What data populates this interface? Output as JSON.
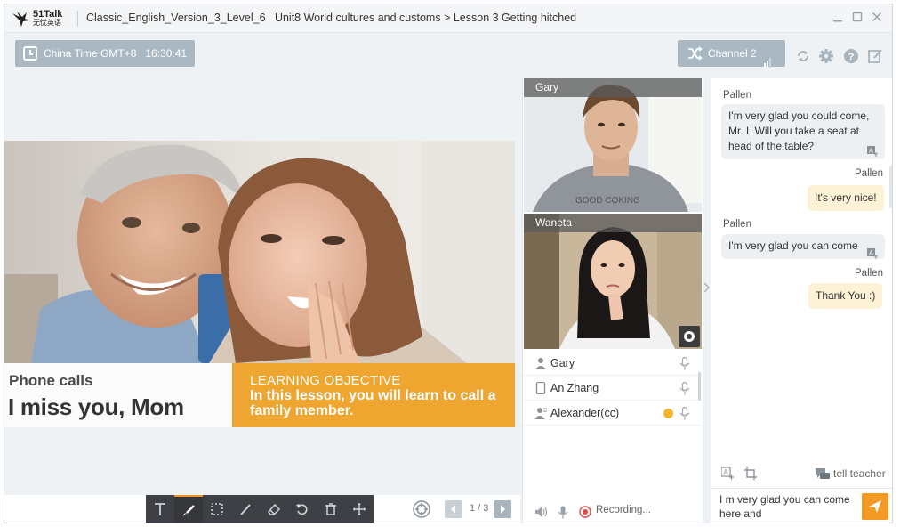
{
  "titlebar": {
    "brand": "51Talk",
    "brand_sub": "无忧英语",
    "title": "Classic_English_Version_3_Level_6   Unit8 World cultures and customs > Lesson 3 Getting hitched",
    "controls": [
      "minimize-icon",
      "maximize-icon",
      "close-icon"
    ]
  },
  "toolbar": {
    "time_label": "China Time GMT+8",
    "time_value": "16:30:41",
    "channel_label": "Channel 2",
    "icons": [
      "refresh-icon",
      "settings-gear-icon",
      "help-icon",
      "feedback-edit-icon"
    ]
  },
  "slide": {
    "title_small": "Phone calls",
    "title_big": "I miss you, Mom",
    "objective_heading": "LEARNING OBJECTIVE",
    "objective_text": "In this lesson, you will learn to call a family member.",
    "objective_color": "#eea631"
  },
  "slide_tools": {
    "tools": [
      "text-tool-icon",
      "brush-tool-icon",
      "select-tool-icon",
      "pen-tool-icon",
      "eraser-tool-icon",
      "undo-icon",
      "delete-icon",
      "move-icon"
    ],
    "active_tool": "brush-tool-icon",
    "page_current": "1",
    "page_total": "3",
    "page_text": "1 / 3"
  },
  "videos": [
    {
      "name": "Gary"
    },
    {
      "name": "Waneta"
    }
  ],
  "members": [
    {
      "name": "Gary",
      "role_icon": "teacher-icon"
    },
    {
      "name": "An Zhang",
      "role_icon": "tablet-icon"
    },
    {
      "name": "Alexander(cc)",
      "role_icon": "cc-user-icon"
    }
  ],
  "recording": {
    "label": "Recording..."
  },
  "chat": {
    "messages": [
      {
        "sender": "Pallen",
        "text": "I'm very glad you could come, Mr. L Will you take a seat at head of the table?",
        "dir": "in"
      },
      {
        "sender": "Pallen",
        "text": "It's very nice!",
        "dir": "out"
      },
      {
        "sender": "Pallen",
        "text": "I'm very glad you can come",
        "dir": "in"
      },
      {
        "sender": "Pallen",
        "text": "Thank You :)",
        "dir": "out"
      }
    ],
    "tell_teacher": "tell teacher",
    "input_value": "I m very glad you can come here and",
    "send_color": "#f39a24"
  }
}
